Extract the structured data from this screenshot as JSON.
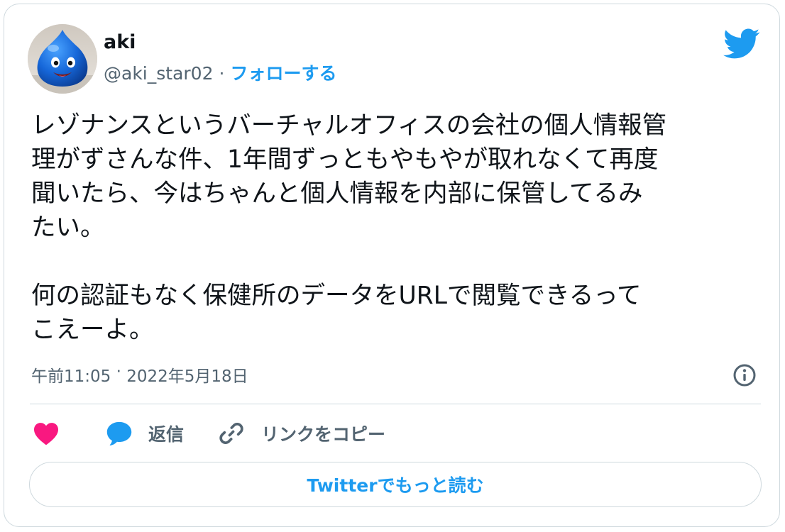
{
  "author": {
    "name": "aki",
    "handle": "@aki_star02",
    "separator": "·",
    "follow_label": "フォローする"
  },
  "tweet": {
    "text": "レゾナンスというバーチャルオフィスの会社の個人情報管\n理がずさんな件、1年間ずっともやもやが取れなくて再度\n聞いたら、今はちゃんと個人情報を内部に保管してるみ\nたい。\n\n何の認証もなく保健所のデータをURLで閲覧できるって\nこえーよ。",
    "time": "午前11:05",
    "separator": " · ",
    "date": "2022年5月18日"
  },
  "actions": {
    "reply_label": "返信",
    "copy_link_label": "リンクをコピー"
  },
  "footer": {
    "read_more_label": "Twitterでもっと読む"
  },
  "icons": {
    "logo": "twitter-bird-icon",
    "info": "info-icon",
    "like": "heart-icon",
    "reply": "speech-bubble-icon",
    "copy": "link-icon"
  },
  "colors": {
    "accent": "#1d9bf0",
    "like": "#f91880",
    "text_primary": "#0f1419",
    "text_secondary": "#536471",
    "border": "#cfd9de"
  }
}
